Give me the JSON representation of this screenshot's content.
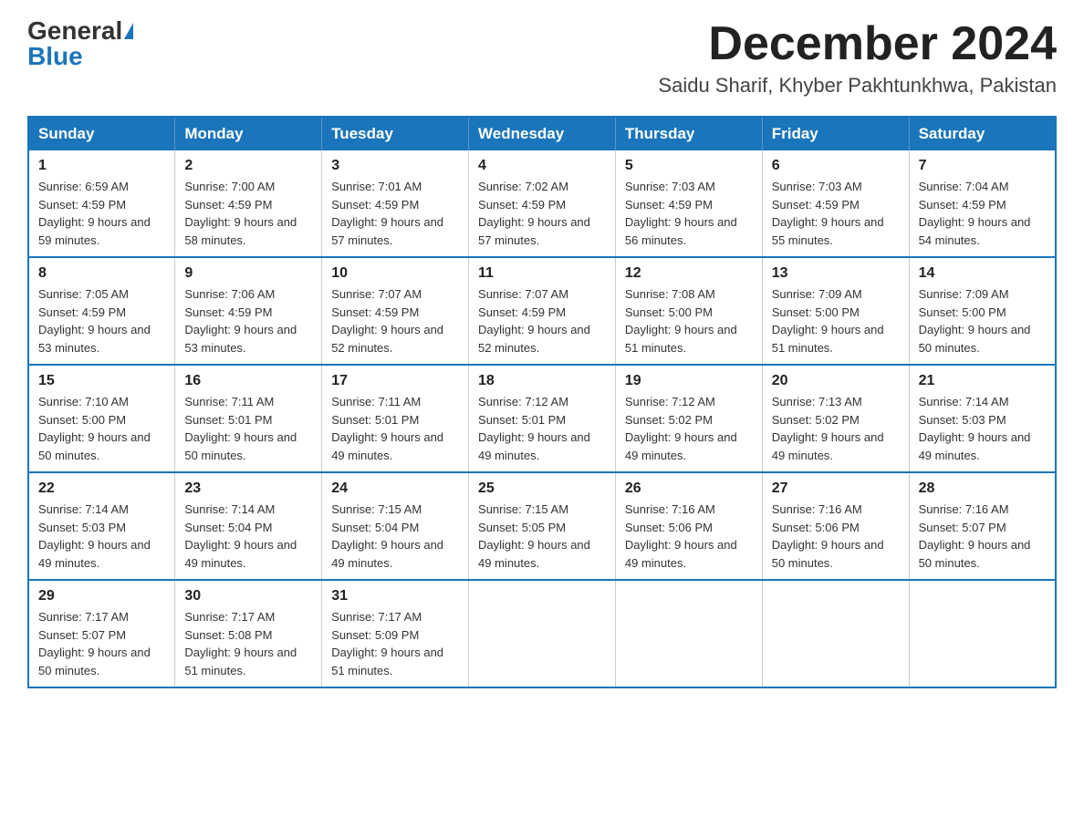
{
  "header": {
    "logo_general": "General",
    "logo_blue": "Blue",
    "month_year": "December 2024",
    "location": "Saidu Sharif, Khyber Pakhtunkhwa, Pakistan"
  },
  "weekdays": [
    "Sunday",
    "Monday",
    "Tuesday",
    "Wednesday",
    "Thursday",
    "Friday",
    "Saturday"
  ],
  "weeks": [
    [
      {
        "day": "1",
        "sunrise": "6:59 AM",
        "sunset": "4:59 PM",
        "daylight": "9 hours and 59 minutes."
      },
      {
        "day": "2",
        "sunrise": "7:00 AM",
        "sunset": "4:59 PM",
        "daylight": "9 hours and 58 minutes."
      },
      {
        "day": "3",
        "sunrise": "7:01 AM",
        "sunset": "4:59 PM",
        "daylight": "9 hours and 57 minutes."
      },
      {
        "day": "4",
        "sunrise": "7:02 AM",
        "sunset": "4:59 PM",
        "daylight": "9 hours and 57 minutes."
      },
      {
        "day": "5",
        "sunrise": "7:03 AM",
        "sunset": "4:59 PM",
        "daylight": "9 hours and 56 minutes."
      },
      {
        "day": "6",
        "sunrise": "7:03 AM",
        "sunset": "4:59 PM",
        "daylight": "9 hours and 55 minutes."
      },
      {
        "day": "7",
        "sunrise": "7:04 AM",
        "sunset": "4:59 PM",
        "daylight": "9 hours and 54 minutes."
      }
    ],
    [
      {
        "day": "8",
        "sunrise": "7:05 AM",
        "sunset": "4:59 PM",
        "daylight": "9 hours and 53 minutes."
      },
      {
        "day": "9",
        "sunrise": "7:06 AM",
        "sunset": "4:59 PM",
        "daylight": "9 hours and 53 minutes."
      },
      {
        "day": "10",
        "sunrise": "7:07 AM",
        "sunset": "4:59 PM",
        "daylight": "9 hours and 52 minutes."
      },
      {
        "day": "11",
        "sunrise": "7:07 AM",
        "sunset": "4:59 PM",
        "daylight": "9 hours and 52 minutes."
      },
      {
        "day": "12",
        "sunrise": "7:08 AM",
        "sunset": "5:00 PM",
        "daylight": "9 hours and 51 minutes."
      },
      {
        "day": "13",
        "sunrise": "7:09 AM",
        "sunset": "5:00 PM",
        "daylight": "9 hours and 51 minutes."
      },
      {
        "day": "14",
        "sunrise": "7:09 AM",
        "sunset": "5:00 PM",
        "daylight": "9 hours and 50 minutes."
      }
    ],
    [
      {
        "day": "15",
        "sunrise": "7:10 AM",
        "sunset": "5:00 PM",
        "daylight": "9 hours and 50 minutes."
      },
      {
        "day": "16",
        "sunrise": "7:11 AM",
        "sunset": "5:01 PM",
        "daylight": "9 hours and 50 minutes."
      },
      {
        "day": "17",
        "sunrise": "7:11 AM",
        "sunset": "5:01 PM",
        "daylight": "9 hours and 49 minutes."
      },
      {
        "day": "18",
        "sunrise": "7:12 AM",
        "sunset": "5:01 PM",
        "daylight": "9 hours and 49 minutes."
      },
      {
        "day": "19",
        "sunrise": "7:12 AM",
        "sunset": "5:02 PM",
        "daylight": "9 hours and 49 minutes."
      },
      {
        "day": "20",
        "sunrise": "7:13 AM",
        "sunset": "5:02 PM",
        "daylight": "9 hours and 49 minutes."
      },
      {
        "day": "21",
        "sunrise": "7:14 AM",
        "sunset": "5:03 PM",
        "daylight": "9 hours and 49 minutes."
      }
    ],
    [
      {
        "day": "22",
        "sunrise": "7:14 AM",
        "sunset": "5:03 PM",
        "daylight": "9 hours and 49 minutes."
      },
      {
        "day": "23",
        "sunrise": "7:14 AM",
        "sunset": "5:04 PM",
        "daylight": "9 hours and 49 minutes."
      },
      {
        "day": "24",
        "sunrise": "7:15 AM",
        "sunset": "5:04 PM",
        "daylight": "9 hours and 49 minutes."
      },
      {
        "day": "25",
        "sunrise": "7:15 AM",
        "sunset": "5:05 PM",
        "daylight": "9 hours and 49 minutes."
      },
      {
        "day": "26",
        "sunrise": "7:16 AM",
        "sunset": "5:06 PM",
        "daylight": "9 hours and 49 minutes."
      },
      {
        "day": "27",
        "sunrise": "7:16 AM",
        "sunset": "5:06 PM",
        "daylight": "9 hours and 50 minutes."
      },
      {
        "day": "28",
        "sunrise": "7:16 AM",
        "sunset": "5:07 PM",
        "daylight": "9 hours and 50 minutes."
      }
    ],
    [
      {
        "day": "29",
        "sunrise": "7:17 AM",
        "sunset": "5:07 PM",
        "daylight": "9 hours and 50 minutes."
      },
      {
        "day": "30",
        "sunrise": "7:17 AM",
        "sunset": "5:08 PM",
        "daylight": "9 hours and 51 minutes."
      },
      {
        "day": "31",
        "sunrise": "7:17 AM",
        "sunset": "5:09 PM",
        "daylight": "9 hours and 51 minutes."
      },
      null,
      null,
      null,
      null
    ]
  ]
}
